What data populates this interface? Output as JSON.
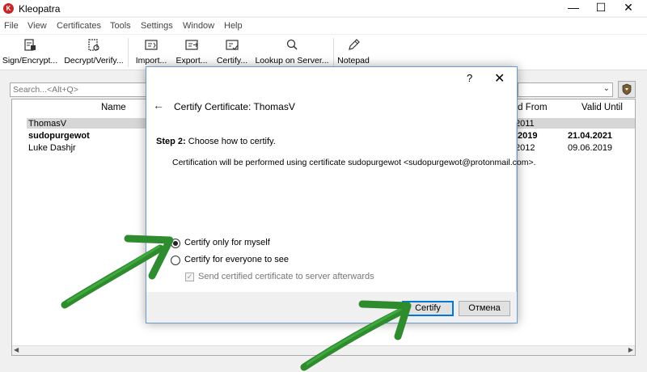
{
  "window": {
    "title": "Kleopatra",
    "app_icon": "K",
    "min_glyph": "—",
    "max_glyph": "☐",
    "close_glyph": "✕"
  },
  "menu": [
    "File",
    "View",
    "Certificates",
    "Tools",
    "Settings",
    "Window",
    "Help"
  ],
  "toolbar": {
    "sign_encrypt": "Sign/Encrypt...",
    "decrypt_verify": "Decrypt/Verify...",
    "import": "Import...",
    "export": "Export...",
    "certify": "Certify...",
    "lookup": "Lookup on Server...",
    "notepad": "Notepad"
  },
  "search": {
    "placeholder": "Search...<Alt+Q>"
  },
  "table": {
    "headers": {
      "name": "Name",
      "valid_from": "lid From",
      "valid_until": "Valid Until"
    },
    "rows": [
      {
        "name": "ThomasV",
        "valid_from": "2011",
        "valid_until": "",
        "bold": false,
        "selected": true
      },
      {
        "name": "sudopurgewot",
        "valid_from": ".2019",
        "valid_until": "21.04.2021",
        "bold": true,
        "selected": false
      },
      {
        "name": "Luke Dashjr",
        "valid_from": "2012",
        "valid_until": "09.06.2019",
        "bold": false,
        "selected": false
      }
    ]
  },
  "dialog": {
    "help": "?",
    "close": "✕",
    "back": "←",
    "title": "Certify Certificate: ThomasV",
    "step_bold": "Step 2:",
    "step_text": " Choose how to certify.",
    "cert_info": "Certification will be performed using certificate sudopurgewot <sudopurgewot@protonmail.com>.",
    "option_self": "Certify only for myself",
    "option_everyone": "Certify for everyone to see",
    "option_self_selected": true,
    "send_checkbox_label": "Send certified certificate to server afterwards",
    "send_checkbox_checked": true,
    "send_checkbox_disabled": true,
    "certify_button": "Certify",
    "cancel_button": "Отмена"
  },
  "colors": {
    "accent": "#0078d7",
    "annotation_arrow": "#2e8b2e"
  }
}
